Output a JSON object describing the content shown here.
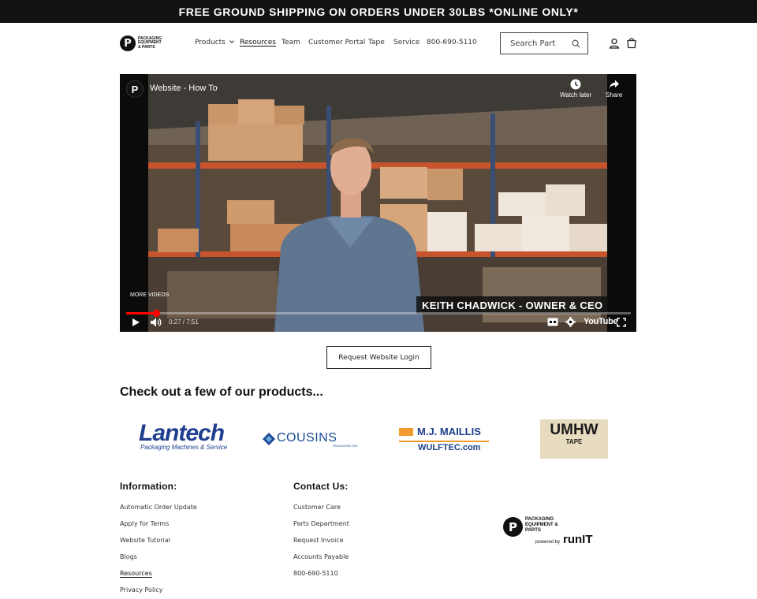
{
  "announcement": "FREE GROUND SHIPPING ON ORDERS UNDER 30LBS *ONLINE ONLY*",
  "logo": {
    "mark": "P",
    "text": "PACKAGING EQUIPMENT & PARTS"
  },
  "nav": {
    "items": [
      {
        "label": "Products",
        "has_dropdown": true
      },
      {
        "label": "Resources",
        "active": true
      },
      {
        "label": "Team"
      },
      {
        "label": "Customer Portal"
      },
      {
        "label": "Tape"
      },
      {
        "label": "Service"
      },
      {
        "label": "800-690-5110"
      }
    ]
  },
  "search": {
    "placeholder": "Search Part"
  },
  "video": {
    "channel_mark": "P",
    "title": "Website - How To",
    "watch_later": "Watch later",
    "share": "Share",
    "more_videos": "MORE VIDEOS",
    "caption": "KEITH CHADWICK - OWNER & CEO",
    "time": "0:27 / 7:51",
    "progress": 0.06,
    "brand": "YouTube"
  },
  "login_button": "Request Website Login",
  "products_heading": "Check out a few of our products...",
  "brands": {
    "lantech": {
      "name": "Lantech",
      "tagline": "Packaging Machines & Service"
    },
    "cousins": {
      "name": "COUSINS",
      "sub": "PACKAGING INC"
    },
    "maillis": {
      "name": "M.J. MAILLIS",
      "sub": "WULFTEC.com"
    },
    "umhw": {
      "name": "UMHW",
      "sub": "TAPE"
    }
  },
  "footer": {
    "information": {
      "heading": "Information:",
      "links": [
        "Automatic Order Update",
        "Apply for Terms",
        "Website Tutorial",
        "Blogs",
        "Resources",
        "Privacy Policy"
      ]
    },
    "contact": {
      "heading": "Contact Us:",
      "links": [
        "Customer Care",
        "Parts Department",
        "Request Invoice",
        "Accounts Payable",
        "800-690-5110"
      ]
    },
    "logo": {
      "mark": "P",
      "text": "PACKAGING EQUIPMENT & PARTS",
      "powered": "powered by",
      "runit": "runIT"
    }
  },
  "colors": {
    "announce_bg": "#121212",
    "video_progress": "#ff0000",
    "brand_blue": "#1f3e8f",
    "maillis_orange": "#f29a2e"
  }
}
